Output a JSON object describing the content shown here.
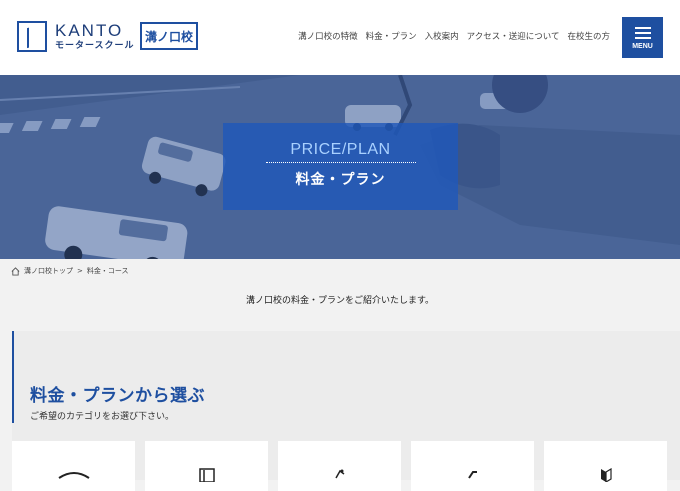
{
  "header": {
    "logo_main": "KANTO",
    "logo_sub": "モータースクール",
    "branch": "溝ノ口校",
    "nav": [
      "溝ノ口校の特徴",
      "料金・プラン",
      "入校案内",
      "アクセス・送迎について",
      "在校生の方"
    ],
    "menu_label": "MENU"
  },
  "hero": {
    "title_en": "PRICE/PLAN",
    "title_jp": "料金・プラン"
  },
  "breadcrumb": {
    "home": "溝ノ口校トップ",
    "separator": ">",
    "current": "料金・コース"
  },
  "intro": "溝ノ口校の料金・プランをご紹介いたします。",
  "section": {
    "title": "料金・プランから選ぶ",
    "subtitle": "ご希望のカテゴリをお選び下さい。"
  },
  "cards": [
    {
      "icon": "car-icon"
    },
    {
      "icon": "door-icon"
    },
    {
      "icon": "motorcycle-icon"
    },
    {
      "icon": "scooter-icon"
    },
    {
      "icon": "beginner-mark-icon"
    }
  ],
  "colors": {
    "brand": "#1e4fa0",
    "background": "#f2f2f2"
  }
}
